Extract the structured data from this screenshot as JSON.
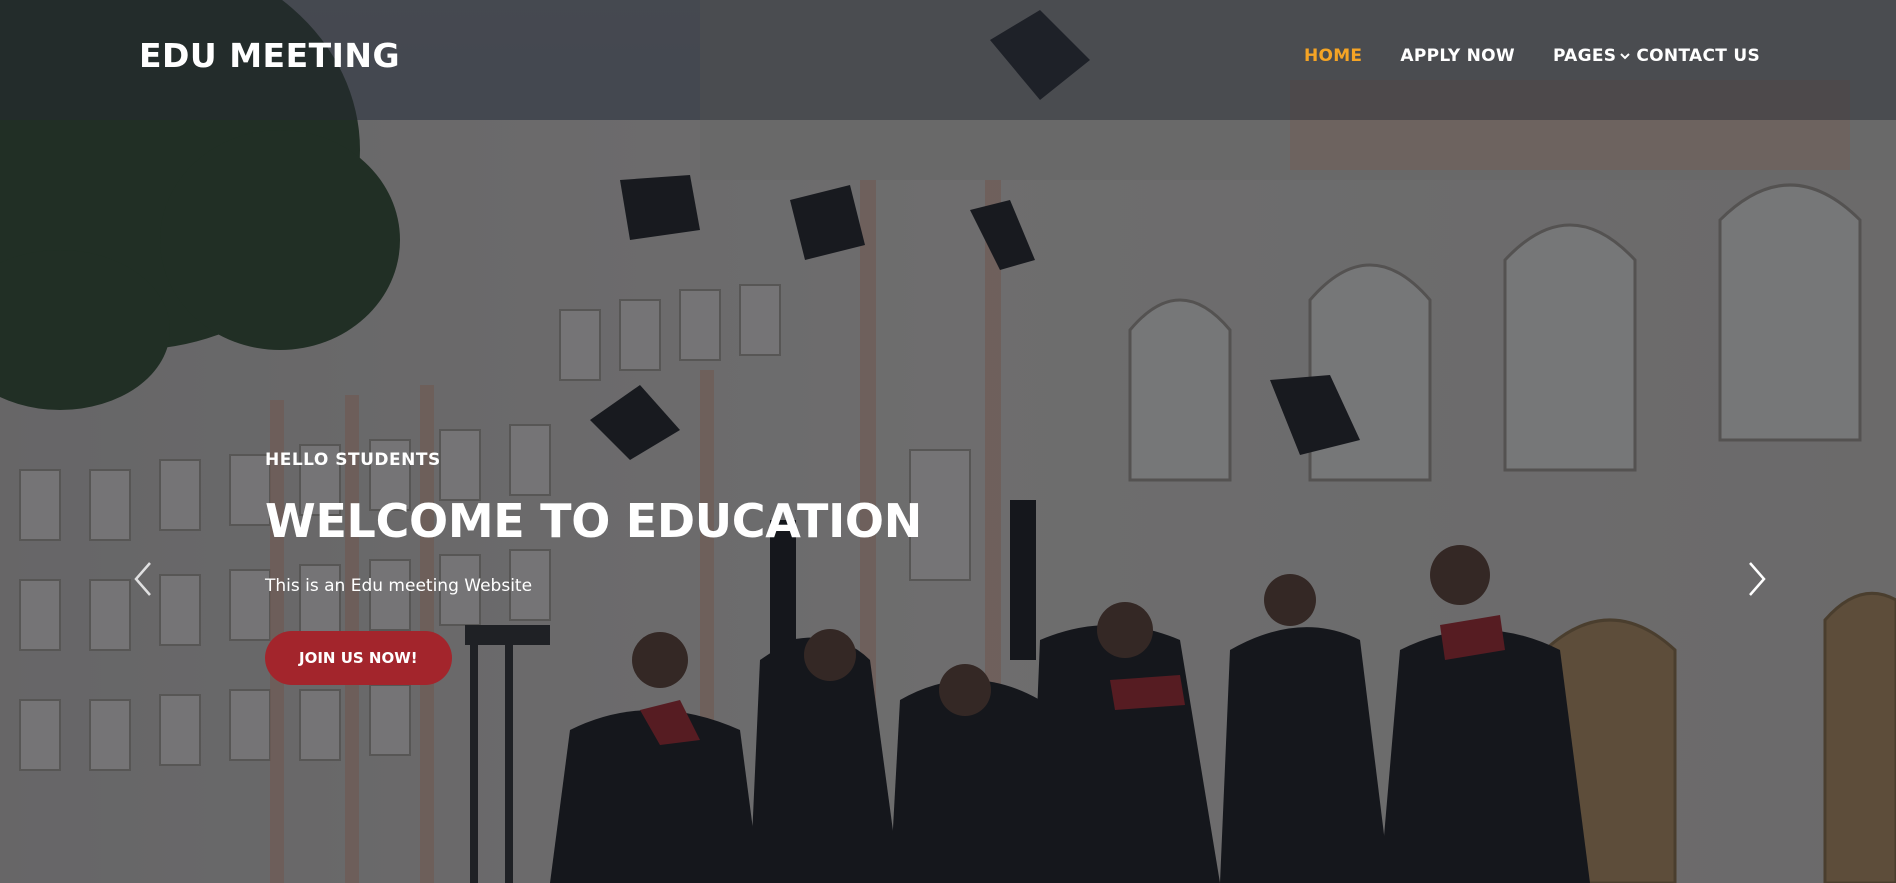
{
  "site": {
    "logo": "EDU MEETING"
  },
  "nav": {
    "items": [
      {
        "label": "HOME",
        "active": true
      },
      {
        "label": "APPLY NOW",
        "active": false
      },
      {
        "label": "PAGES",
        "active": false,
        "has_dropdown": true
      },
      {
        "label": "CONTACT US",
        "active": false
      }
    ]
  },
  "hero": {
    "eyebrow": "HELLO STUDENTS",
    "headline": "WELCOME TO EDUCATION",
    "subtext": "This is an Edu meeting Website",
    "cta_label": "JOIN US NOW!"
  },
  "carousel": {
    "prev_icon": "chevron-left-icon",
    "next_icon": "chevron-right-icon"
  },
  "colors": {
    "accent": "#f5a425",
    "cta": "#a3252c",
    "text": "#ffffff"
  }
}
